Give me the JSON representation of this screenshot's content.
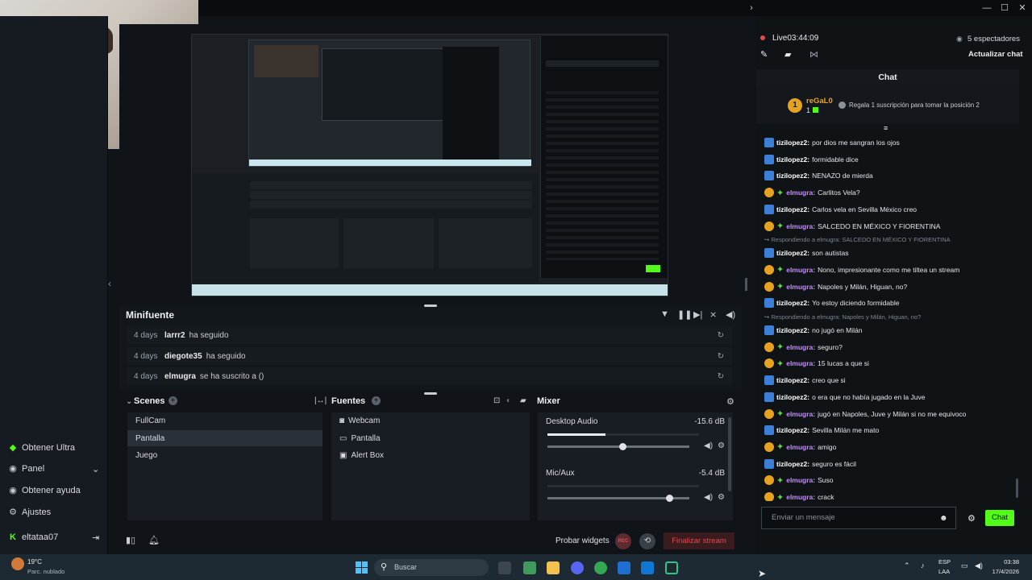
{
  "left_nav": {
    "items": [
      {
        "label": "Obtener Ultra",
        "icon": "ultra-icon"
      },
      {
        "label": "Panel",
        "icon": "panel-icon"
      },
      {
        "label": "Obtener ayuda",
        "icon": "help-icon"
      },
      {
        "label": "Ajustes",
        "icon": "settings-icon"
      }
    ],
    "user": "eltataa07"
  },
  "minifeed": {
    "title": "Minifuente",
    "rows": [
      {
        "ago": "4 days",
        "user": "larrr2",
        "action": "ha seguido"
      },
      {
        "ago": "4 days",
        "user": "diegote35",
        "action": "ha seguido"
      },
      {
        "ago": "4 days",
        "user": "elmugra",
        "action": "se ha suscrito a ()"
      }
    ]
  },
  "scenes": {
    "title": "Scenes",
    "items": [
      "FullCam",
      "Pantalla",
      "Juego"
    ],
    "selected": "Pantalla"
  },
  "sources": {
    "title": "Fuentes",
    "items": [
      {
        "label": "Webcam",
        "icon": "webcam-icon"
      },
      {
        "label": "Pantalla",
        "icon": "monitor-icon"
      },
      {
        "label": "Alert Box",
        "icon": "image-icon"
      }
    ]
  },
  "mixer": {
    "title": "Mixer",
    "channels": [
      {
        "name": "Desktop Audio",
        "db": "-15.6 dB",
        "level": 0.53
      },
      {
        "name": "Mic/Aux",
        "db": "-5.4 dB",
        "level": 0.86
      }
    ]
  },
  "bottom_bar": {
    "test_widgets": "Probar widgets",
    "rec": "REC",
    "end_stream": "Finalizar stream"
  },
  "chat_panel": {
    "live_label": "Live",
    "live_time": "03:44:09",
    "viewers": "5 espectadores",
    "refresh_chat": "Actualizar chat",
    "title": "Chat",
    "gift": {
      "badge_number": "1",
      "user": "reGaL0",
      "count": "1",
      "text": "Regala 1 suscripción para tomar la posición 2"
    },
    "messages": [
      {
        "type": "msg",
        "badge": "blue",
        "user": "tizilopez2",
        "text": "por dios me sangran los ojos"
      },
      {
        "type": "msg",
        "badge": "blue",
        "user": "tizilopez2",
        "text": "formidable dice"
      },
      {
        "type": "msg",
        "badge": "blue",
        "user": "tizilopez2",
        "text": "NENAZO de mierda"
      },
      {
        "type": "msg",
        "badge": "sub",
        "user": "elmugra",
        "text": "Carlitos Vela?"
      },
      {
        "type": "msg",
        "badge": "blue",
        "user": "tizilopez2",
        "text": "Carlos vela en Sevilla México creo"
      },
      {
        "type": "msg",
        "badge": "sub",
        "user": "elmugra",
        "text": "SALCEDO EN MÉXICO Y FIORENTINA"
      },
      {
        "type": "reply",
        "text": "Respondiendo a elmugra: SALCEDO EN MÉXICO Y FIORENTINA"
      },
      {
        "type": "msg",
        "badge": "blue",
        "user": "tizilopez2",
        "text": "son autistas"
      },
      {
        "type": "msg",
        "badge": "sub",
        "user": "elmugra",
        "text": "Nono, impresionante como me tiltea un stream"
      },
      {
        "type": "msg",
        "badge": "sub",
        "user": "elmugra",
        "text": "Napoles y Milán, Higuan, no?"
      },
      {
        "type": "msg",
        "badge": "blue",
        "user": "tizilopez2",
        "text": "Yo estoy diciendo formidable"
      },
      {
        "type": "reply",
        "text": "Respondiendo a elmugra: Napoles y Milán, Higuan, no?"
      },
      {
        "type": "msg",
        "badge": "blue",
        "user": "tizilopez2",
        "text": "no jugó en Milán"
      },
      {
        "type": "msg",
        "badge": "sub",
        "user": "elmugra",
        "text": "seguro?"
      },
      {
        "type": "msg",
        "badge": "sub",
        "user": "elmugra",
        "text": "15 lucas a que si"
      },
      {
        "type": "msg",
        "badge": "blue",
        "user": "tizilopez2",
        "text": "creo que si"
      },
      {
        "type": "msg",
        "badge": "blue",
        "user": "tizilopez2",
        "text": "o era que no había jugado en la Juve"
      },
      {
        "type": "msg",
        "badge": "sub",
        "user": "elmugra",
        "text": "jugó en Napoles, Juve y Milán si no me equivoco"
      },
      {
        "type": "msg",
        "badge": "blue",
        "user": "tizilopez2",
        "text": "Sevilla Milán me mato"
      },
      {
        "type": "msg",
        "badge": "sub",
        "user": "elmugra",
        "text": "amigo"
      },
      {
        "type": "msg",
        "badge": "blue",
        "user": "tizilopez2",
        "text": "seguro es fácil"
      },
      {
        "type": "msg",
        "badge": "sub",
        "user": "elmugra",
        "text": "Suso"
      },
      {
        "type": "msg",
        "badge": "sub",
        "user": "elmugra",
        "text": "crack"
      }
    ],
    "input_placeholder": "Enviar un mensaje",
    "send_label": "Chat"
  },
  "taskbar": {
    "weather_temp": "19°C",
    "weather_desc": "Parc. nublado",
    "search_placeholder": "Buscar",
    "lang_top": "ESP",
    "lang_bottom": "LAA",
    "time": "03:38",
    "date": "17/4/2026"
  },
  "colors": {
    "accent_green": "#53fc18",
    "live_red": "#e5484d",
    "end_stream_red": "#e5484d",
    "sub_purple": "#c58cff"
  }
}
